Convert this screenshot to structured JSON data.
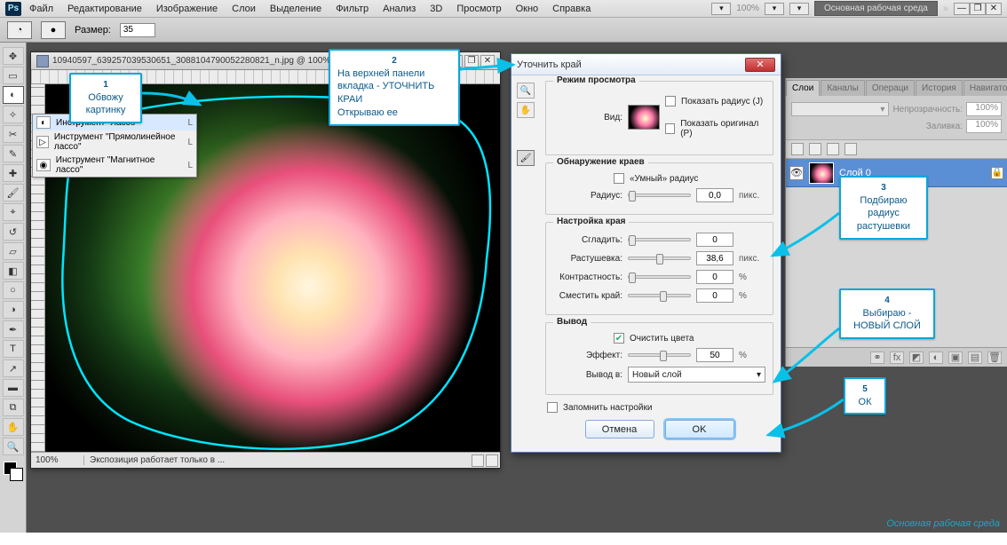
{
  "menubar": {
    "items": [
      "Файл",
      "Редактирование",
      "Изображение",
      "Слои",
      "Выделение",
      "Фильтр",
      "Анализ",
      "3D",
      "Просмотр",
      "Окно",
      "Справка"
    ],
    "zoom_label": "100%",
    "workspace_button": "Основная рабочая среда",
    "chevrons": "»"
  },
  "optionsbar": {
    "size_label": "Размер:",
    "size_value": "35"
  },
  "document": {
    "tab_title": "10940597_639257039530651_3088104790052280821_n.jpg @ 100% (Сло...",
    "status_zoom": "100%",
    "status_info": "Экспозиция работает только в ..."
  },
  "lasso_flyout": {
    "items": [
      {
        "label": "Инструмент \"Лассо\"",
        "key": "L"
      },
      {
        "label": "Инструмент \"Прямолинейное лассо\"",
        "key": "L"
      },
      {
        "label": "Инструмент \"Магнитное лассо\"",
        "key": "L"
      }
    ]
  },
  "dialog": {
    "title": "Уточнить край",
    "view_mode_legend": "Режим просмотра",
    "view_label": "Вид:",
    "show_radius": "Показать радиус (J)",
    "show_original": "Показать оригинал (P)",
    "edge_detection_legend": "Обнаружение краев",
    "smart_radius": "«Умный» радиус",
    "radius_label": "Радиус:",
    "radius_value": "0,0",
    "radius_unit": "пикс.",
    "adjust_edge_legend": "Настройка края",
    "smooth_label": "Сгладить:",
    "smooth_value": "0",
    "feather_label": "Растушевка:",
    "feather_value": "38,6",
    "feather_unit": "пикс.",
    "contrast_label": "Контрастность:",
    "contrast_value": "0",
    "contrast_unit": "%",
    "shift_label": "Сместить край:",
    "shift_value": "0",
    "shift_unit": "%",
    "output_legend": "Вывод",
    "decontaminate": "Очистить цвета",
    "amount_label": "Эффект:",
    "amount_value": "50",
    "amount_unit": "%",
    "output_to_label": "Вывод в:",
    "output_to_value": "Новый слой",
    "remember": "Запомнить настройки",
    "cancel": "Отмена",
    "ok": "OK"
  },
  "panels": {
    "tabs": [
      "Слои",
      "Каналы",
      "Операци",
      "История",
      "Навигато"
    ],
    "blend_placeholder": "",
    "opacity_label": "Непрозрачность:",
    "opacity_value": "100%",
    "fill_label": "Заливка:",
    "fill_value": "100%",
    "lock_label": "",
    "layer0": "Слой 0"
  },
  "callouts": {
    "c1_num": "1",
    "c1_text": "Обвожу картинку",
    "c2_num": "2",
    "c2_text": "На верхней панели вкладка - УТОЧНИТЬ КРАИ\nОткрываю ее",
    "c3_num": "3",
    "c3_text": "Подбираю радиус растушевки",
    "c4_num": "4",
    "c4_text": "Выбираю - НОВЫЙ СЛОЙ",
    "c5_num": "5",
    "c5_text": "ОК"
  },
  "brand": "Основная рабочая среда"
}
